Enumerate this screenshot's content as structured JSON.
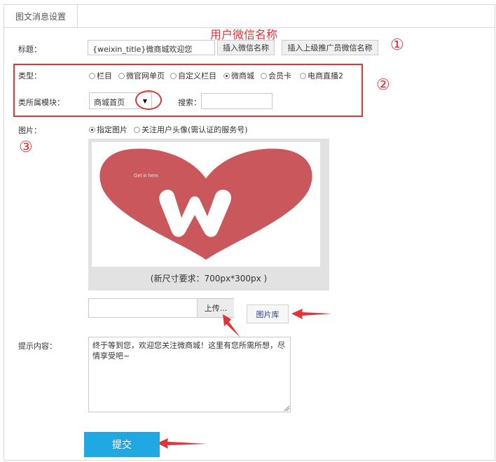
{
  "tab": {
    "label": "图文消息设置"
  },
  "annotations": {
    "username": "用户微信名称",
    "num1": "①",
    "num2": "②",
    "num3": "③"
  },
  "title_row": {
    "label": "标题：",
    "value": "{weixin_title}微商城欢迎您",
    "insert_name_btn": "插入微信名称",
    "insert_promoter_btn": "插入上级推广员微信名称"
  },
  "type_row": {
    "label": "类型：",
    "options": [
      "栏目",
      "微官网单页",
      "自定义栏目",
      "微商城",
      "会员卡",
      "电商直播2"
    ],
    "selected_index": 3
  },
  "module_row": {
    "label": "类所属模块：",
    "selected": "商城首页",
    "search_label": "搜索：",
    "search_value": ""
  },
  "image_row": {
    "label": "图片：",
    "options": [
      "指定图片",
      "关注用户头像(需认证的服务号)"
    ],
    "selected_index": 0,
    "preview_text": "Get in here.",
    "caption": "(新尺寸要求：700px*300px )",
    "upload_btn": "上传...",
    "library_btn": "图片库"
  },
  "prompt_row": {
    "label": "提示内容：",
    "value": "终于等到您，欢迎您关注微商城！这里有您所需所想，尽情享受吧~"
  },
  "submit_btn": "提交",
  "colors": {
    "accent_red": "#d9373b",
    "submit_blue": "#1fa8e1",
    "heart": "#c9575b"
  }
}
